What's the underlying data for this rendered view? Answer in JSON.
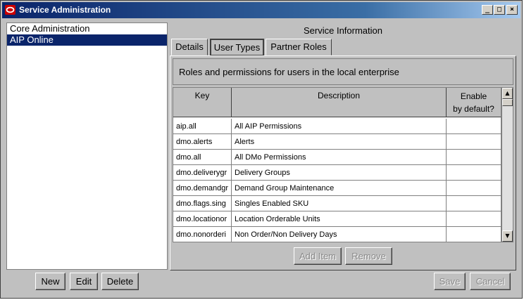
{
  "window": {
    "title": "Service Administration",
    "minimize_glyph": "_",
    "maximize_glyph": "□",
    "close_glyph": "×"
  },
  "services": {
    "items": [
      {
        "label": "Core Administration",
        "selected": false
      },
      {
        "label": "AIP Online",
        "selected": true
      }
    ]
  },
  "info": {
    "title": "Service Information",
    "tabs": [
      {
        "label": "Details",
        "active": false
      },
      {
        "label": "User Types",
        "active": true
      },
      {
        "label": "Partner Roles",
        "active": false
      }
    ],
    "description": "Roles and permissions for users in the local enterprise"
  },
  "table": {
    "headers": {
      "key": "Key",
      "description": "Description",
      "enable_line1": "Enable",
      "enable_line2": "by default?"
    },
    "rows": [
      {
        "key": "aip.all",
        "description": "All AIP Permissions"
      },
      {
        "key": "dmo.alerts",
        "description": "Alerts"
      },
      {
        "key": "dmo.all",
        "description": "All DMo Permissions"
      },
      {
        "key": "dmo.deliverygr",
        "description": "Delivery Groups"
      },
      {
        "key": "dmo.demandgr",
        "description": "Demand Group Maintenance"
      },
      {
        "key": "dmo.flags.sing",
        "description": "Singles Enabled SKU"
      },
      {
        "key": "dmo.locationor",
        "description": "Location Orderable Units"
      },
      {
        "key": "dmo.nonorderi",
        "description": "Non Order/Non Delivery Days"
      }
    ]
  },
  "buttons": {
    "add_item": "Add Item",
    "remove": "Remove",
    "new": "New",
    "edit": "Edit",
    "delete": "Delete",
    "save": "Save",
    "cancel": "Cancel"
  },
  "icons": {
    "app": "oracle-logo-icon",
    "scroll_up": "arrow-up-icon",
    "scroll_down": "arrow-down-icon"
  },
  "colors": {
    "title_bar": "#0a246a",
    "selection": "#0a246a",
    "app_icon": "#cc0000"
  }
}
